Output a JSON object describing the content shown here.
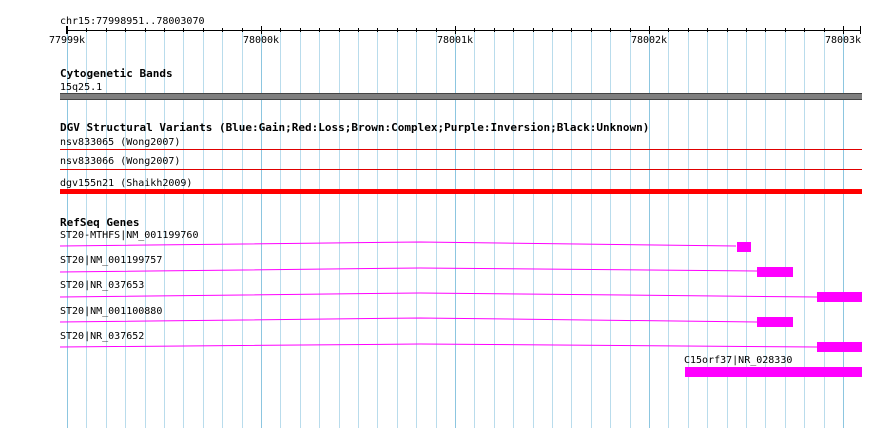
{
  "location": "chr15:77998951..78003070",
  "ruler": {
    "ticks": [
      {
        "label": "77999k",
        "pos": 77999000
      },
      {
        "label": "78000k",
        "pos": 78000000
      },
      {
        "label": "78001k",
        "pos": 78001000
      },
      {
        "label": "78002k",
        "pos": 78002000
      },
      {
        "label": "78003k",
        "pos": 78003000
      }
    ]
  },
  "tracks": {
    "cytobands": {
      "title": "Cytogenetic Bands",
      "band_label": "15q25.1",
      "color": "#7f7f7f"
    },
    "dgv": {
      "title": "DGV Structural Variants (Blue:Gain;Red:Loss;Brown:Complex;Purple:Inversion;Black:Unknown)",
      "items": [
        {
          "label": "nsv833065 (Wong2007)",
          "style": "thin",
          "color": "#e00000"
        },
        {
          "label": "nsv833066 (Wong2007)",
          "style": "thin",
          "color": "#e00000"
        },
        {
          "label": "dgv155n21 (Shaikh2009)",
          "style": "thick",
          "color": "#ff0000"
        }
      ]
    },
    "refseq": {
      "title": "RefSeq Genes",
      "color": "#ff00ff",
      "genes": [
        {
          "label": "ST20-MTHFS|NM_001199760"
        },
        {
          "label": "ST20|NM_001199757"
        },
        {
          "label": "ST20|NR_037653"
        },
        {
          "label": "ST20|NM_001100880"
        },
        {
          "label": "ST20|NR_037652"
        },
        {
          "label": "C15orf37|NR_028330"
        }
      ]
    }
  }
}
